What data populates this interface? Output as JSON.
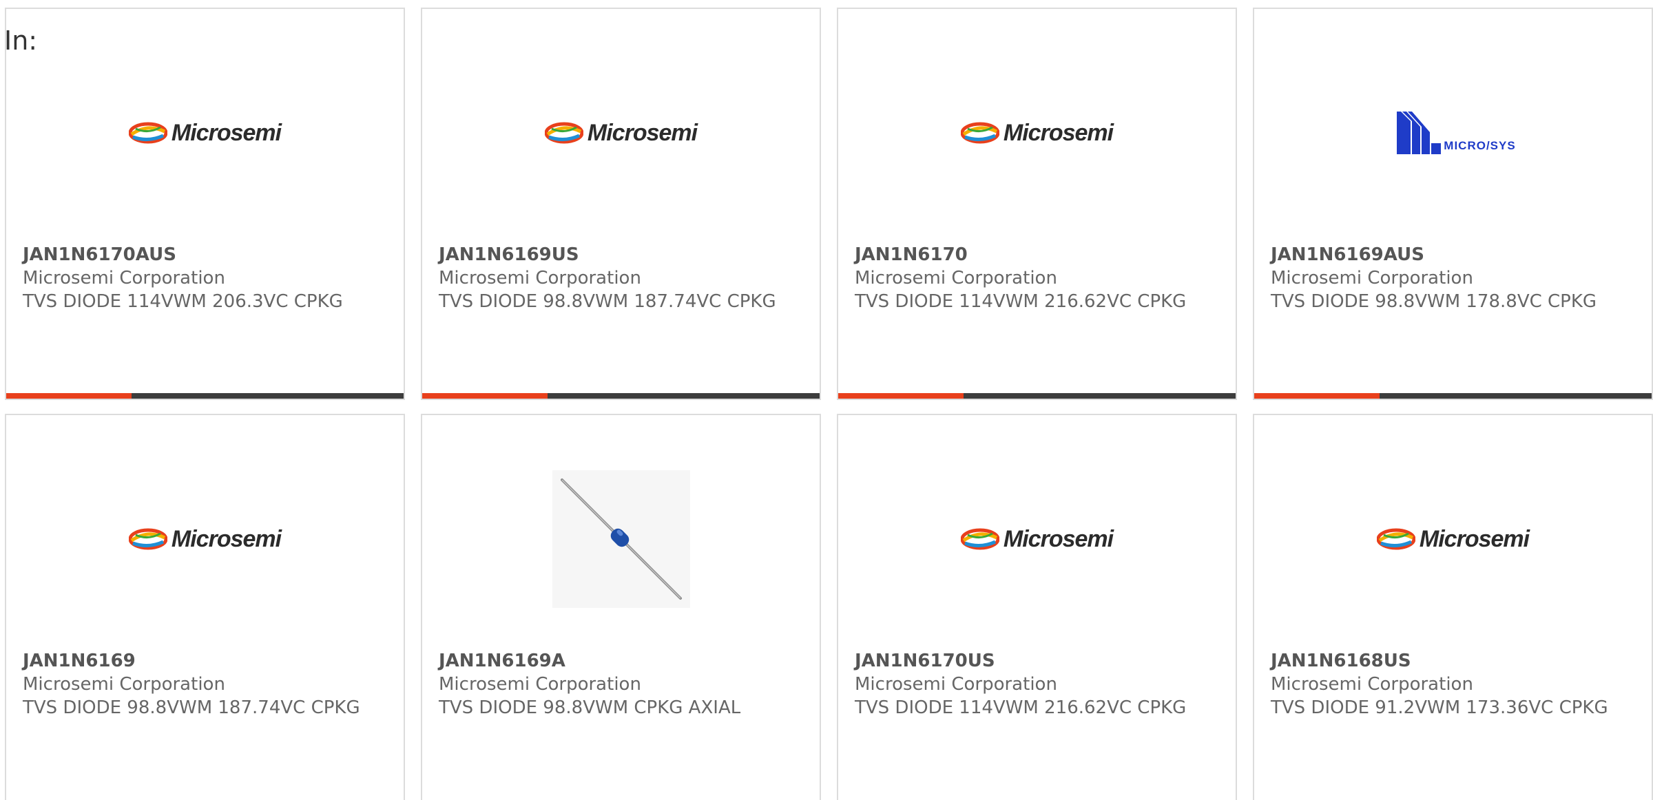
{
  "filter": {
    "label": "In:"
  },
  "colors": {
    "bar_accent": "#e8401c",
    "bar_rest": "#3d3d3d",
    "ms_text": "#2b2b2b",
    "mss_blue": "#1f3cc8"
  },
  "logos": {
    "microsemi": "Microsemi",
    "microsys": "MICRO/SYS"
  },
  "products": [
    {
      "part": "JAN1N6170AUS",
      "maker": "Microsemi Corporation",
      "desc": "TVS DIODE 114VWM 206.3VC CPKG",
      "image": "microsemi-logo"
    },
    {
      "part": "JAN1N6169US",
      "maker": "Microsemi Corporation",
      "desc": "TVS DIODE 98.8VWM 187.74VC CPKG",
      "image": "microsemi-logo"
    },
    {
      "part": "JAN1N6170",
      "maker": "Microsemi Corporation",
      "desc": "TVS DIODE 114VWM 216.62VC CPKG",
      "image": "microsemi-logo"
    },
    {
      "part": "JAN1N6169AUS",
      "maker": "Microsemi Corporation",
      "desc": "TVS DIODE 98.8VWM 178.8VC CPKG",
      "image": "microsys-logo"
    },
    {
      "part": "JAN1N6169",
      "maker": "Microsemi Corporation",
      "desc": "TVS DIODE 98.8VWM 187.74VC CPKG",
      "image": "microsemi-logo"
    },
    {
      "part": "JAN1N6169A",
      "maker": "Microsemi Corporation",
      "desc": "TVS DIODE 98.8VWM CPKG AXIAL",
      "image": "axial-diode-photo"
    },
    {
      "part": "JAN1N6170US",
      "maker": "Microsemi Corporation",
      "desc": "TVS DIODE 114VWM 216.62VC CPKG",
      "image": "microsemi-logo"
    },
    {
      "part": "JAN1N6168US",
      "maker": "Microsemi Corporation",
      "desc": "TVS DIODE 91.2VWM 173.36VC CPKG",
      "image": "microsemi-logo"
    }
  ]
}
